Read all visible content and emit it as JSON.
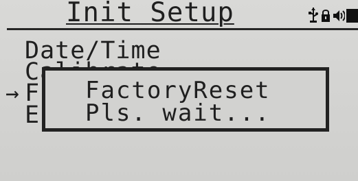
{
  "device": {
    "screen_title": "Init Setup"
  },
  "status_icons": [
    "usb-icon",
    "lock-icon",
    "speaker-icon",
    "battery-icon"
  ],
  "menu": {
    "selection_marker": "→",
    "items": [
      {
        "label": "Date/Time"
      },
      {
        "label": "Calibrate"
      },
      {
        "label": "F"
      },
      {
        "label": "E"
      }
    ]
  },
  "dialog": {
    "line_1": "FactoryReset",
    "line_2": "Pls. wait..."
  },
  "colors": {
    "screen_background": "#d5d5d3",
    "foreground": "#1f1f1f"
  }
}
